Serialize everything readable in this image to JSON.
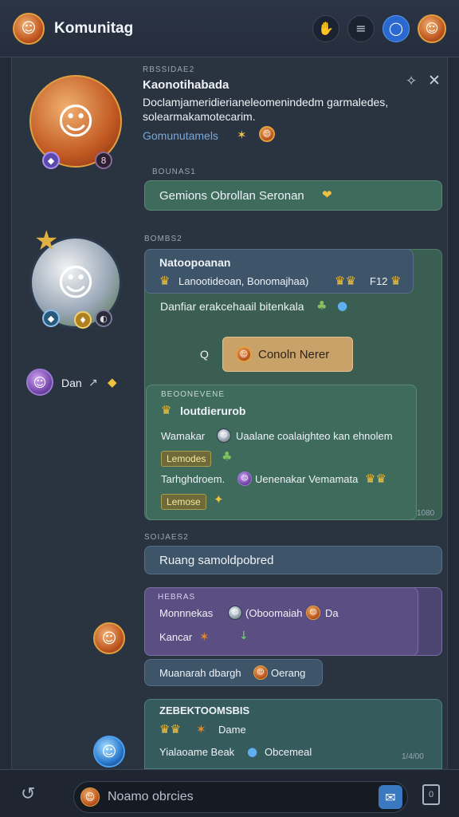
{
  "header": {
    "title": "Komunitag",
    "icons": [
      "hand-icon",
      "menu-icon",
      "ring-icon",
      "avatar"
    ]
  },
  "post": {
    "tag": "RBSSIDAE2",
    "title": "Kaonotihabada",
    "body_line1": "Doclamjameridierianeleomenindedm garmaledes,",
    "body_line2": "solearmakamotecarim.",
    "link": "Gomunutamels",
    "badge_num": "8"
  },
  "reply1": {
    "tag": "BOUNAS1",
    "text": "Gemions Obrollan Seronan"
  },
  "group": {
    "tag": "BOMBS2",
    "card": {
      "title": "Natoopoanan",
      "subtitle": "Lanootideoan, Bonomajhaa)",
      "extra": "F12"
    },
    "line": "Danfiar erakcehaail bitenkala",
    "button_prefix": "Q",
    "button_label": "Conoln Nerer",
    "side_user": "Dan"
  },
  "nested": {
    "tag": "BEOONEVENE",
    "title": "loutdierurob",
    "row1_label": "Wamakar",
    "row1_text": "Uaalane coalaighteo kan ehnolem",
    "chip1": "Lemodes",
    "row2_label": "Tarhghdroem.",
    "row2_text": "Uenenakar Vemamata",
    "chip2": "Lemose",
    "corner": "1080"
  },
  "reply2": {
    "tag": "SOIJAES2",
    "text": "Ruang samoldpobred"
  },
  "purple_msg": {
    "tag": "HEBRAS",
    "line1_a": "Monnnekas",
    "line1_b": "(Oboomaiah",
    "line1_c": "Da",
    "line2": "Kancar"
  },
  "small_reply": {
    "text": "Muanarah dbargh",
    "text2": "Oerang"
  },
  "last_card": {
    "title": "ZEBEKTOOMSBIS",
    "line1": "Dame",
    "line2_a": "Yialaoame Beak",
    "line2_b": "Obcemeal",
    "corner": "1/4/00"
  },
  "composer": {
    "placeholder": "Noamo obrcies",
    "right_badge": "0"
  }
}
